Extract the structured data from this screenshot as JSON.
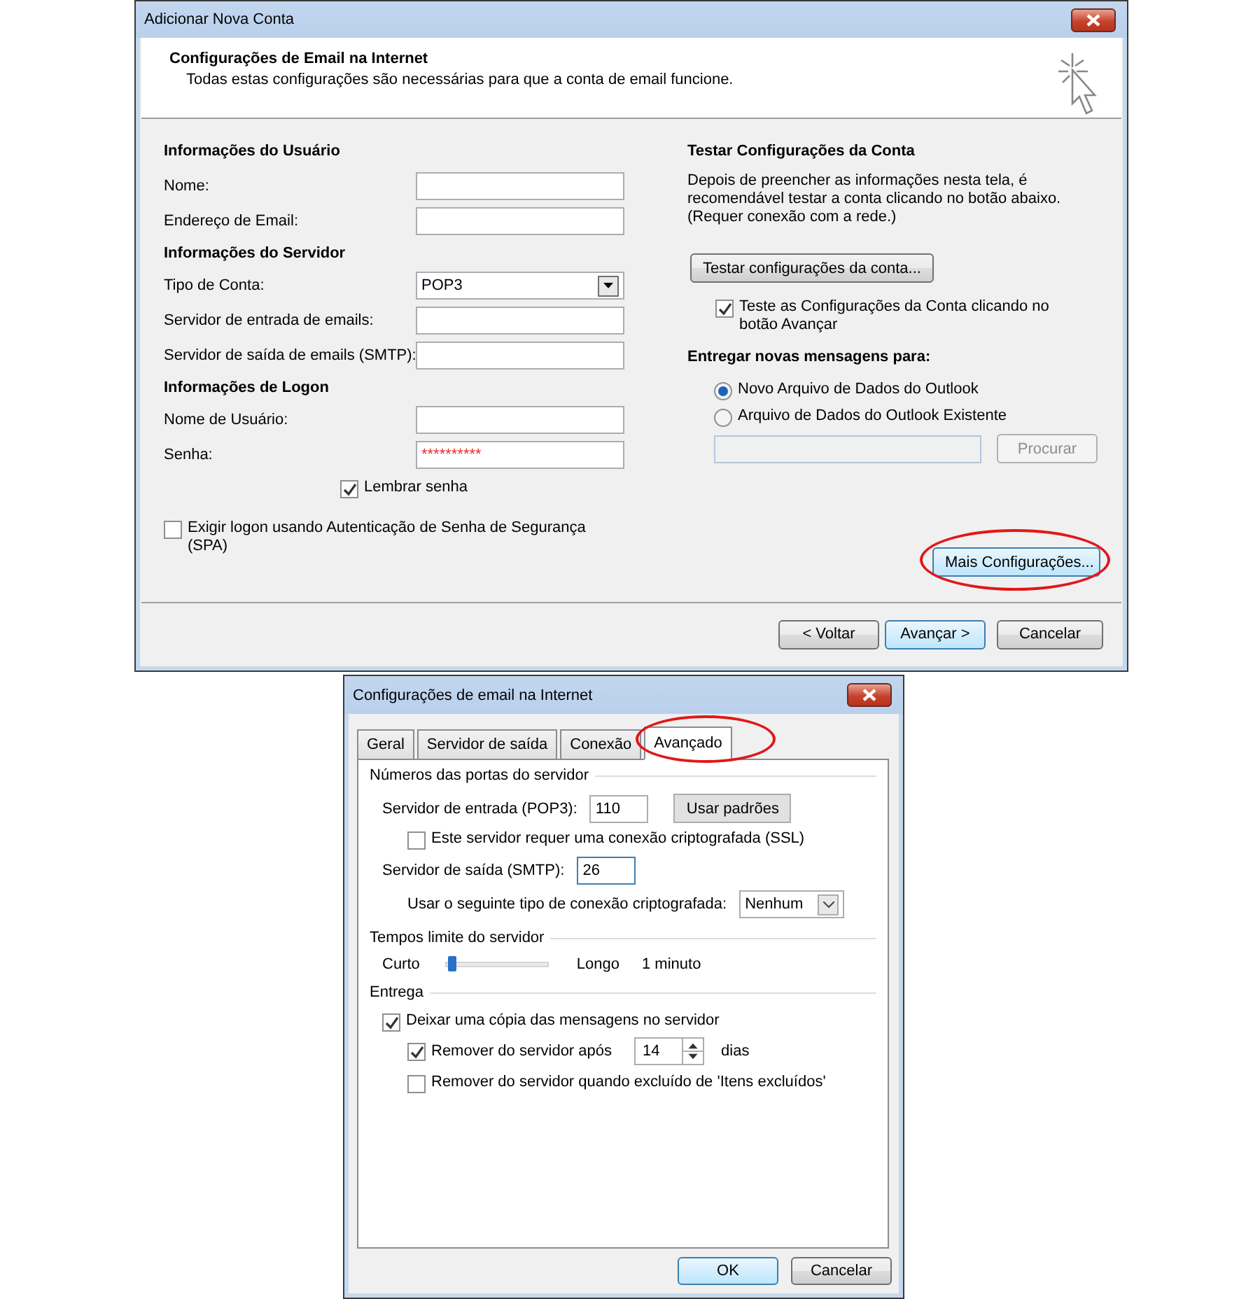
{
  "main_dialog": {
    "title": "Adicionar Nova Conta",
    "header": {
      "title": "Configurações de Email na Internet",
      "subtitle": "Todas estas configurações são necessárias para que a conta de email funcione."
    },
    "sections": [
      {
        "heading": "Informações do Usuário",
        "fields": [
          {
            "label": "Nome:",
            "kind": "text"
          },
          {
            "label": "Endereço de Email:",
            "kind": "text"
          }
        ]
      },
      {
        "heading": "Informações do Servidor",
        "fields": [
          {
            "label": "Tipo de Conta:",
            "kind": "dropdown",
            "value": "POP3"
          },
          {
            "label": "Servidor de entrada de emails:",
            "kind": "text"
          },
          {
            "label": "Servidor de saída de emails (SMTP):",
            "kind": "text"
          }
        ]
      },
      {
        "heading": "Informações de Logon",
        "fields": [
          {
            "label": "Nome de Usuário:",
            "kind": "text"
          },
          {
            "label": "Senha:",
            "kind": "password",
            "value": "**********"
          }
        ]
      }
    ],
    "remember_password": {
      "label": "Lembrar senha",
      "checked": true
    },
    "require_spa": {
      "label": "Exigir logon usando Autenticação de Senha de Segurança (SPA)",
      "checked": false
    },
    "test_section": {
      "heading": "Testar Configurações da Conta",
      "description": "Depois de preencher as informações nesta tela, é recomendável testar a conta clicando no botão abaixo. (Requer conexão com a rede.)",
      "button": "Testar configurações da conta...",
      "test_on_next": {
        "label": "Teste as Configurações da Conta clicando no botão Avançar",
        "checked": true
      }
    },
    "delivery": {
      "heading": "Entregar novas mensagens para:",
      "options": [
        {
          "label": "Novo Arquivo de Dados do Outlook",
          "selected": true
        },
        {
          "label": "Arquivo de Dados do Outlook Existente",
          "selected": false
        }
      ],
      "browse_button": {
        "label": "Procurar",
        "disabled": true
      }
    },
    "more_settings_button": {
      "label": "Mais Configurações...",
      "highlighted": true
    },
    "buttons": [
      {
        "label": "< Voltar",
        "default": false
      },
      {
        "label": "Avançar >",
        "default": true
      },
      {
        "label": "Cancelar",
        "default": false
      }
    ]
  },
  "settings_dialog": {
    "title": "Configurações de email na Internet",
    "tabs": [
      {
        "label": "Geral",
        "selected": false,
        "highlighted": false
      },
      {
        "label": "Servidor de saída",
        "selected": false,
        "highlighted": false
      },
      {
        "label": "Conexão",
        "selected": false,
        "highlighted": false
      },
      {
        "label": "Avançado",
        "selected": true,
        "highlighted": true
      }
    ],
    "ports": {
      "heading": "Números das portas do servidor",
      "incoming": {
        "label": "Servidor de entrada (POP3):",
        "value": "110"
      },
      "defaults_button": "Usar padrões",
      "ssl": {
        "label": "Este servidor requer uma conexão criptografada (SSL)",
        "checked": false
      },
      "outgoing": {
        "label": "Servidor de saída (SMTP):",
        "value": "26",
        "focused": true
      },
      "encryption": {
        "label": "Usar o seguinte tipo de conexão criptografada:",
        "value": "Nenhum"
      }
    },
    "timeouts": {
      "heading": "Tempos limite do servidor",
      "min_label": "Curto",
      "max_label": "Longo",
      "reading": "1 minuto",
      "level": 0.05
    },
    "delivery": {
      "heading": "Entrega",
      "leave_copy": {
        "label": "Deixar uma cópia das mensagens no servidor",
        "checked": true
      },
      "remove_after": {
        "label": "Remover do servidor após",
        "checked": true,
        "value": "14",
        "unit": "dias"
      },
      "remove_deleted": {
        "label": "Remover do servidor quando excluído de 'Itens excluídos'",
        "checked": false
      }
    },
    "buttons": [
      {
        "label": "OK",
        "default": true
      },
      {
        "label": "Cancelar",
        "default": false
      }
    ]
  }
}
